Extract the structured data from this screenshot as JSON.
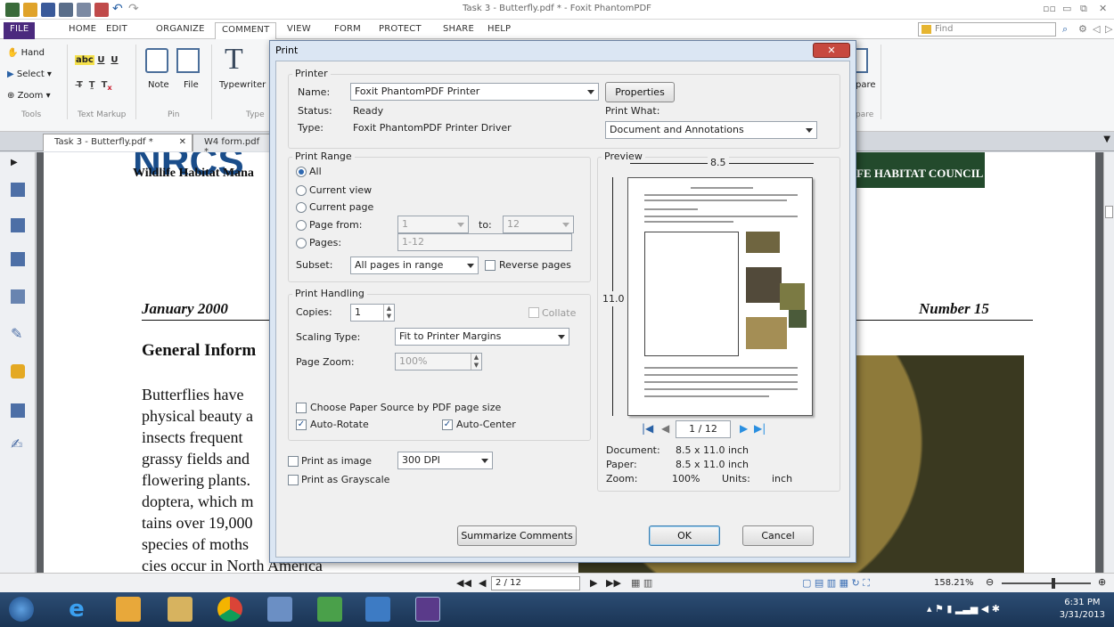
{
  "app": {
    "window_title": "Task 3 - Butterfly.pdf * - Foxit PhantomPDF",
    "tabs": [
      "FILE",
      "HOME",
      "EDIT",
      "ORGANIZE",
      "COMMENT",
      "VIEW",
      "FORM",
      "PROTECT",
      "SHARE",
      "HELP"
    ],
    "find_placeholder": "Find"
  },
  "ribbon": {
    "hand": "Hand",
    "select": "Select",
    "zoom": "Zoom",
    "tools_group": "Tools",
    "text_markup_group": "Text Markup",
    "note": "Note",
    "file": "File",
    "pin_group": "Pin",
    "typewriter": "Typewriter",
    "type_group": "Type",
    "compare": "pare",
    "compare_group": "pare"
  },
  "doc_tabs": [
    "Task 3 - Butterfly.pdf *",
    "W4 form.pdf *"
  ],
  "page_content": {
    "nrcs": "NRCS",
    "wildlife": "Wildlife Habitat Mana",
    "whc": "FE HABITAT COUNCIL",
    "date": "January 2000",
    "number": "Number 15",
    "heading": "General Inform",
    "para": [
      "Butterflies have",
      "physical beauty a",
      "insects frequent",
      "grassy fields and",
      "flowering plants.",
      "doptera, which m",
      "tains over 19,000",
      "species of moths",
      "cies occur in North America"
    ]
  },
  "dialog": {
    "title": "Print",
    "printer": {
      "legend": "Printer",
      "name_label": "Name:",
      "name_value": "Foxit PhantomPDF Printer",
      "status_label": "Status:",
      "status_value": "Ready",
      "type_label": "Type:",
      "type_value": "Foxit PhantomPDF Printer Driver",
      "properties": "Properties",
      "print_what_label": "Print What:",
      "print_what_value": "Document and Annotations"
    },
    "range": {
      "legend": "Print Range",
      "all": "All",
      "current_view": "Current view",
      "current_page": "Current page",
      "page_from": "Page from:",
      "from_value": "1",
      "to": "to:",
      "to_value": "12",
      "pages": "Pages:",
      "pages_value": "1-12",
      "subset_label": "Subset:",
      "subset_value": "All pages in range",
      "reverse": "Reverse pages"
    },
    "handling": {
      "legend": "Print Handling",
      "copies_label": "Copies:",
      "copies_value": "1",
      "collate": "Collate",
      "scaling_label": "Scaling Type:",
      "scaling_value": "Fit to Printer Margins",
      "zoom_label": "Page Zoom:",
      "zoom_value": "100%",
      "paper_source": "Choose Paper Source by PDF page size",
      "auto_rotate": "Auto-Rotate",
      "auto_center": "Auto-Center"
    },
    "print_as_image": "Print as image",
    "dpi_value": "300 DPI",
    "grayscale": "Print as Grayscale",
    "summarize": "Summarize Comments",
    "ok": "OK",
    "cancel": "Cancel",
    "preview": {
      "legend": "Preview",
      "width": "8.5",
      "height": "11.0",
      "page_indicator": "1 / 12",
      "document_label": "Document:",
      "document_value": "8.5 x 11.0 inch",
      "paper_label": "Paper:",
      "paper_value": "8.5 x 11.0 inch",
      "zoom_label": "Zoom:",
      "zoom_value": "100%",
      "units_label": "Units:",
      "units_value": "inch"
    }
  },
  "statusbar": {
    "page_indicator": "2 / 12",
    "zoom": "158.21%"
  },
  "taskbar": {
    "time": "6:31 PM",
    "date": "3/31/2013"
  }
}
